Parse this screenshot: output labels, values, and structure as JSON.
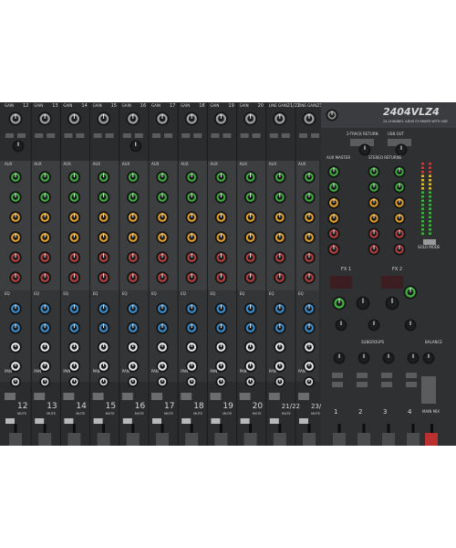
{
  "brand": {
    "model": "2404VLZ4",
    "tagline": "24-CHANNEL 4-BUS FX MIXER WITH USB"
  },
  "colors": {
    "panel": "#2a2c2e",
    "panel_light": "#4a4c4e",
    "gain": "#9a9a9a",
    "aux_green": "#3fae3f",
    "aux_orange": "#e6a02a",
    "aux_red": "#b84040",
    "eq_blue": "#3b8fd0",
    "eq_white": "#e6e6e6"
  },
  "channels": [
    {
      "gain": "GAIN",
      "num": "12",
      "label": "12",
      "type": "mono"
    },
    {
      "gain": "GAIN",
      "num": "13",
      "label": "13",
      "type": "mono"
    },
    {
      "gain": "GAIN",
      "num": "14",
      "label": "14",
      "type": "mono"
    },
    {
      "gain": "GAIN",
      "num": "15",
      "label": "15",
      "type": "mono"
    },
    {
      "gain": "GAIN",
      "num": "16",
      "label": "16",
      "type": "mono"
    },
    {
      "gain": "GAIN",
      "num": "17",
      "label": "17",
      "type": "mono"
    },
    {
      "gain": "GAIN",
      "num": "18",
      "label": "18",
      "type": "mono"
    },
    {
      "gain": "GAIN",
      "num": "19",
      "label": "19",
      "type": "mono"
    },
    {
      "gain": "GAIN",
      "num": "20",
      "label": "20",
      "type": "mono"
    },
    {
      "gain": "LINE GAIN",
      "num": "21/22",
      "label": "21/22",
      "type": "stereo"
    },
    {
      "gain": "LINE GAIN",
      "num": "23/24",
      "label": "23/24",
      "type": "stereo"
    }
  ],
  "strip": {
    "aux": "AUX",
    "eq": "EQ",
    "pan": "PAN",
    "mute": "MUTE"
  },
  "master": {
    "stereo_return": "2-TRACK RETURN",
    "usb": "USB OUT",
    "aux_master": "AUX MASTER",
    "stereo_returns": "STEREO RETURNS",
    "fx1": "FX 1",
    "fx2": "FX 2",
    "subgroups": "SUBGROUPS",
    "balance": "BALANCE",
    "solo_mode": "SOLO MODE",
    "main_mix": "MAIN MIX",
    "sub_nums": [
      "1",
      "2",
      "3",
      "4"
    ]
  }
}
